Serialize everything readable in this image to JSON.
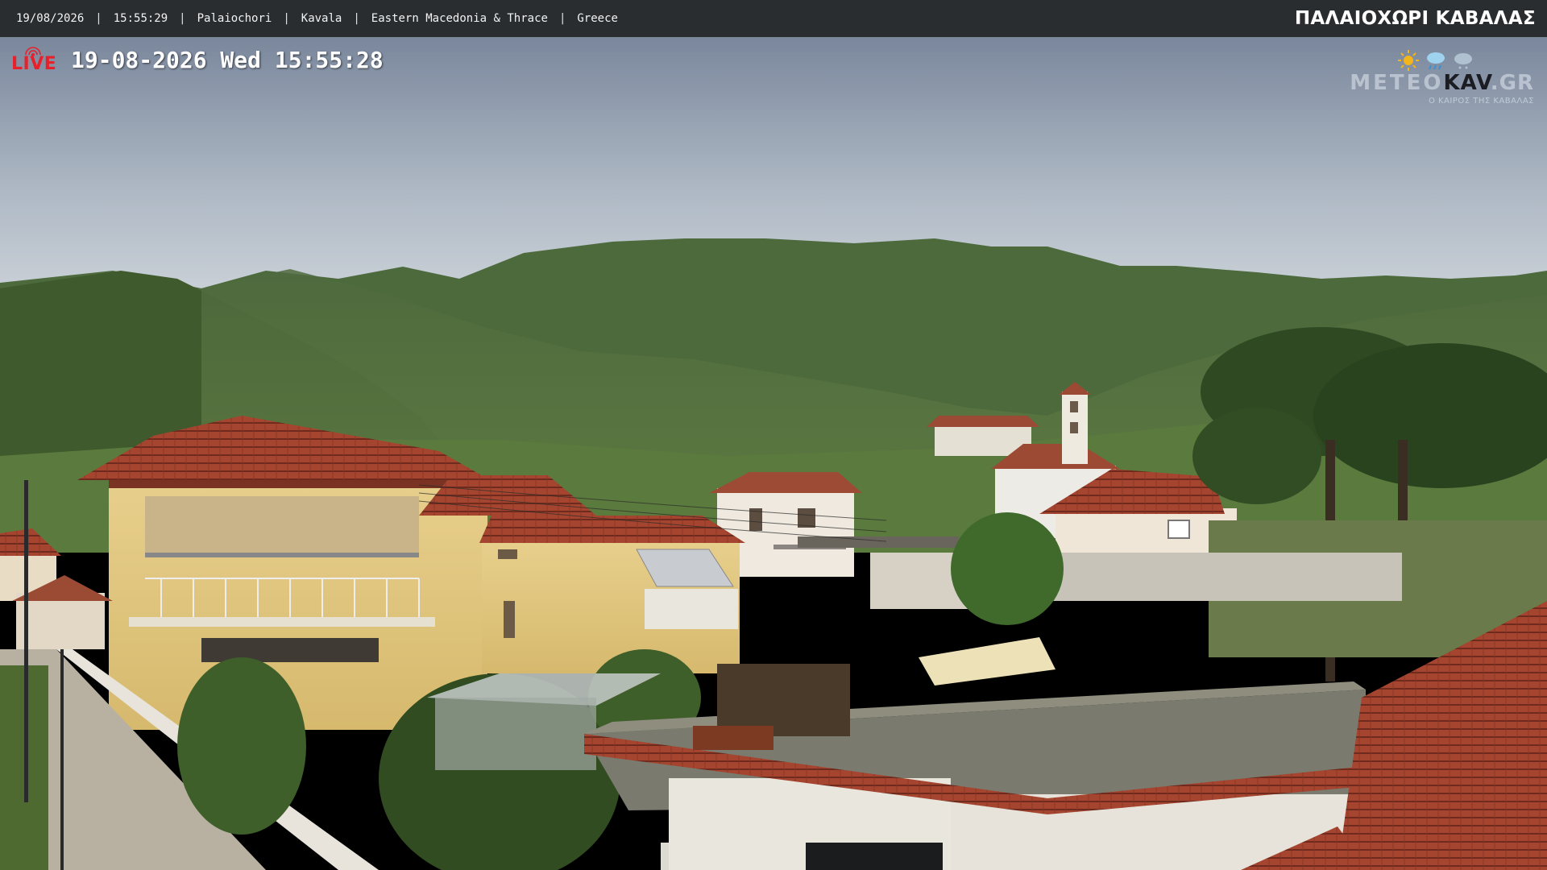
{
  "topbar": {
    "date": "19/08/2026",
    "time": "15:55:29",
    "village": "Palaiochori",
    "city": "Kavala",
    "region": "Eastern Macedonia & Thrace",
    "country": "Greece",
    "separator": "|",
    "title": "ΠΑΛΑΙΟΧΩΡΙ ΚΑΒΑΛΑΣ"
  },
  "overlay": {
    "live_label": "LIVE",
    "live_icon": "broadcast-icon",
    "timestamp": "19-08-2026 Wed 15:55:28"
  },
  "logo": {
    "part1": "METEO",
    "part2": "KAV",
    "part3": ".GR",
    "tagline": "Ο ΚΑΙΡΟΣ ΤΗΣ ΚΑΒΑΛΑΣ",
    "icons": [
      "sun-icon",
      "rain-cloud-icon",
      "snow-cloud-icon"
    ]
  },
  "colors": {
    "topbar_bg": "#2a2d30",
    "live_red": "#e8202a",
    "roof_tile": "#a8432f",
    "sky_top": "#7d8aa0",
    "sky_horizon": "#d9dee3"
  }
}
